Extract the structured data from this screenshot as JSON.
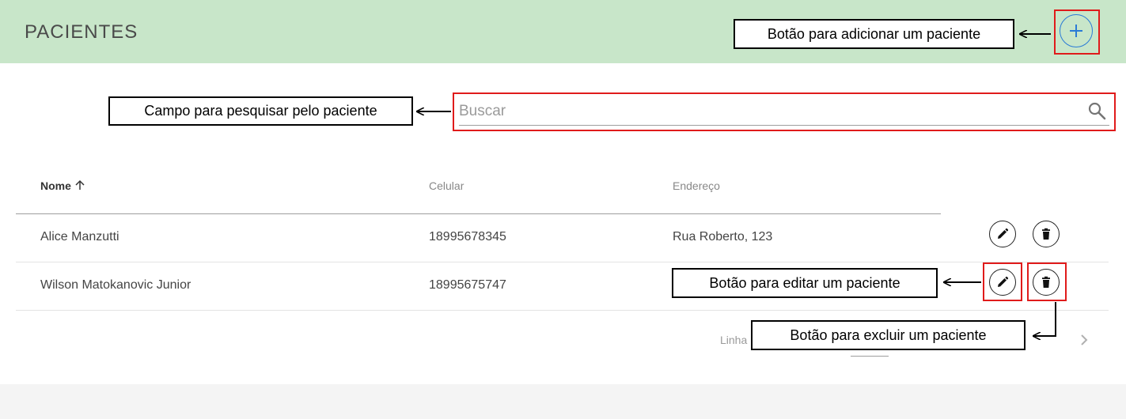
{
  "header": {
    "title": "PACIENTES",
    "add_icon": "plus-icon",
    "accent_color": "#2a7bd6",
    "background_color": "#c8e6c9"
  },
  "search": {
    "placeholder": "Buscar",
    "value": "",
    "icon": "search-icon"
  },
  "table": {
    "columns": [
      {
        "label": "Nome",
        "sort": "asc"
      },
      {
        "label": "Celular"
      },
      {
        "label": "Endereço"
      }
    ],
    "rows": [
      {
        "nome": "Alice Manzutti",
        "celular": "18995678345",
        "endereco": "Rua Roberto, 123"
      },
      {
        "nome": "Wilson Matokanovic Junior",
        "celular": "18995675747",
        "endereco": ""
      }
    ],
    "row_action_icons": [
      "pencil-icon",
      "trash-icon"
    ]
  },
  "pagination": {
    "label_visible": "Linha",
    "next_icon": "chevron-right-icon"
  },
  "annotations": {
    "add_button": "Botão para adicionar um paciente",
    "search_field": "Campo para pesquisar pelo paciente",
    "edit_button": "Botão para editar um paciente",
    "delete_button": "Botão para excluir um paciente",
    "highlight_color": "#e01b1b"
  }
}
